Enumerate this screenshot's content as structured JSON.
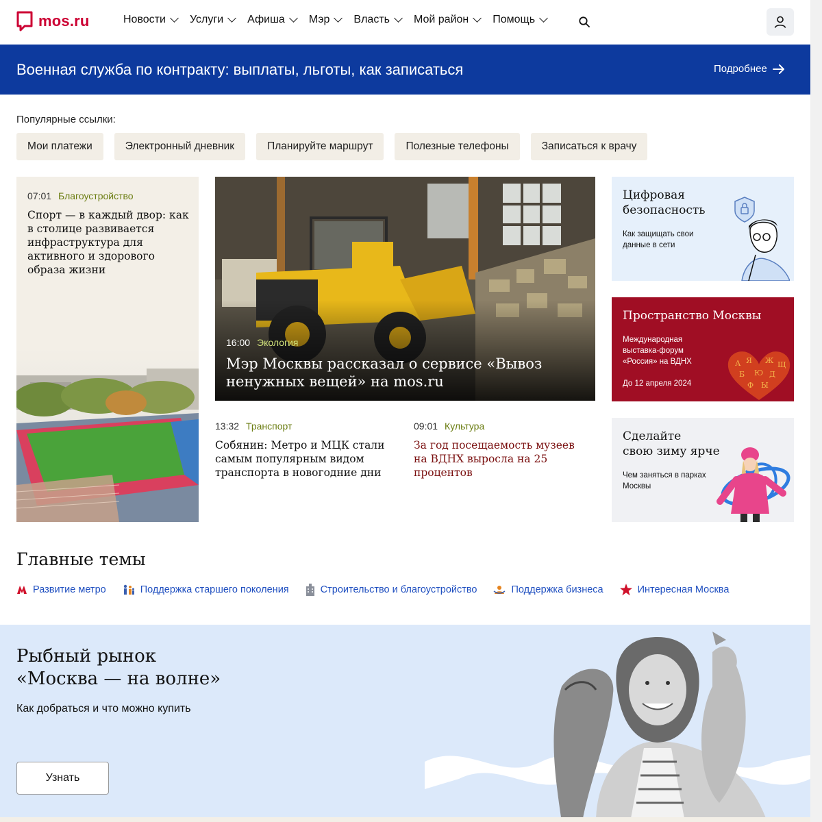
{
  "header": {
    "logo_text": "mos.ru",
    "nav": [
      {
        "label": "Новости"
      },
      {
        "label": "Услуги"
      },
      {
        "label": "Афиша"
      },
      {
        "label": "Мэр"
      },
      {
        "label": "Власть"
      },
      {
        "label": "Мой район"
      },
      {
        "label": "Помощь"
      }
    ],
    "icons": {
      "search": "search-icon",
      "user": "user-icon"
    }
  },
  "banner": {
    "title": "Военная служба по контракту: выплаты, льготы, как записаться",
    "link": "Подробнее",
    "color": "#0d3a9e"
  },
  "popular": {
    "label": "Популярные ссылки:",
    "links": [
      "Мои платежи",
      "Электронный дневник",
      "Планируйте маршрут",
      "Полезные телефоны",
      "Записаться к врачу"
    ]
  },
  "news": {
    "left": {
      "time": "07:01",
      "category": "Благоустройство",
      "headline": "Спорт — в каждый двор: как в столице развивается инфраструктура для активного и здорового образа жизни"
    },
    "main": {
      "time": "16:00",
      "category": "Экология",
      "headline": "Мэр Москвы рассказал о сервисе «Вывоз ненужных вещей» на mos.ru"
    },
    "small": [
      {
        "time": "13:32",
        "category": "Транспорт",
        "headline": "Собянин: Метро и МЦК стали самым популярным видом транспорта в новогодние дни"
      },
      {
        "time": "09:01",
        "category": "Культура",
        "headline": "За год посещаемость музеев на ВДНХ выросла на 25 процентов"
      }
    ]
  },
  "promos": [
    {
      "title": "Цифровая безопасность",
      "subtitle": "Как защищать свои данные в сети",
      "bg": "#e6f0fb"
    },
    {
      "title": "Пространство Москвы",
      "subtitle": "Международная выставка-форум «Россия» на ВДНХ",
      "date": "До 12 апреля 2024",
      "bg": "#a00e24"
    },
    {
      "title": "Сделайте своюзиму ярче",
      "title_lines": [
        "Сделайте",
        "свою зиму ярче"
      ],
      "subtitle": "Чем заняться в парках Москвы",
      "bg": "#f0f1f4"
    }
  ],
  "themes": {
    "title": "Главные темы",
    "items": [
      {
        "label": "Развитие метро",
        "icon": "metro-icon"
      },
      {
        "label": "Поддержка старшего поколения",
        "icon": "family-icon"
      },
      {
        "label": "Строительство и благоустройство",
        "icon": "building-icon"
      },
      {
        "label": "Поддержка бизнеса",
        "icon": "business-icon"
      },
      {
        "label": "Интересная Москва",
        "icon": "star-icon"
      }
    ]
  },
  "fish_market": {
    "title_lines": [
      "Рыбный рынок",
      "«Москва — на волне»"
    ],
    "subtitle": "Как добраться и что можно купить",
    "button": "Узнать"
  }
}
